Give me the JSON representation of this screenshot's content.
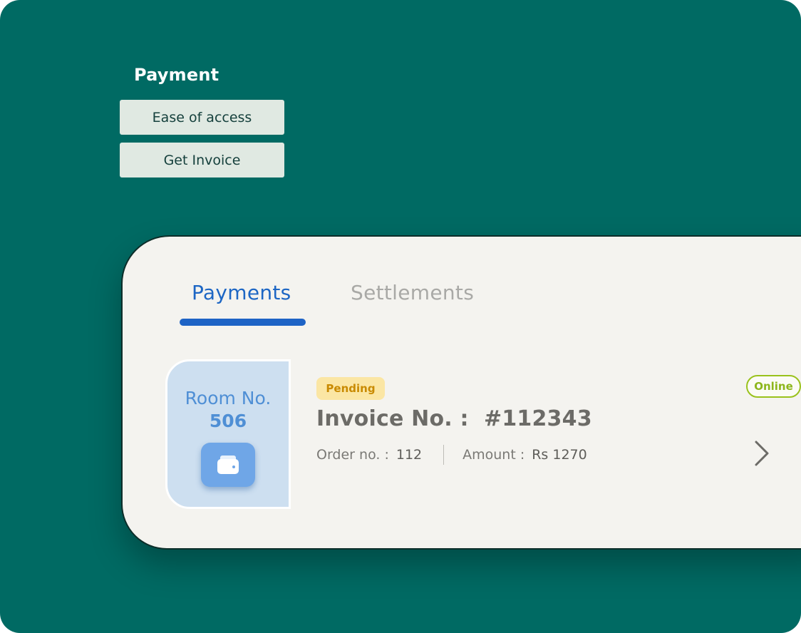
{
  "section": {
    "title": "Payment",
    "features": [
      "Ease of access",
      "Get Invoice"
    ]
  },
  "tabs": {
    "active": "Payments",
    "inactive": "Settlements"
  },
  "room": {
    "label": "Room No.",
    "number": "506",
    "icon": "wallet-icon"
  },
  "invoice": {
    "status": "Pending",
    "payment_mode": "Online",
    "title_label": "Invoice No. :",
    "number": "#112343",
    "order_label": "Order no. :",
    "order_value": "112",
    "amount_label": "Amount :",
    "amount_value": "Rs 1270"
  },
  "colors": {
    "background": "#006a63",
    "accent_blue": "#1e63c5",
    "pending": "#c98a00",
    "online": "#8db61c"
  }
}
